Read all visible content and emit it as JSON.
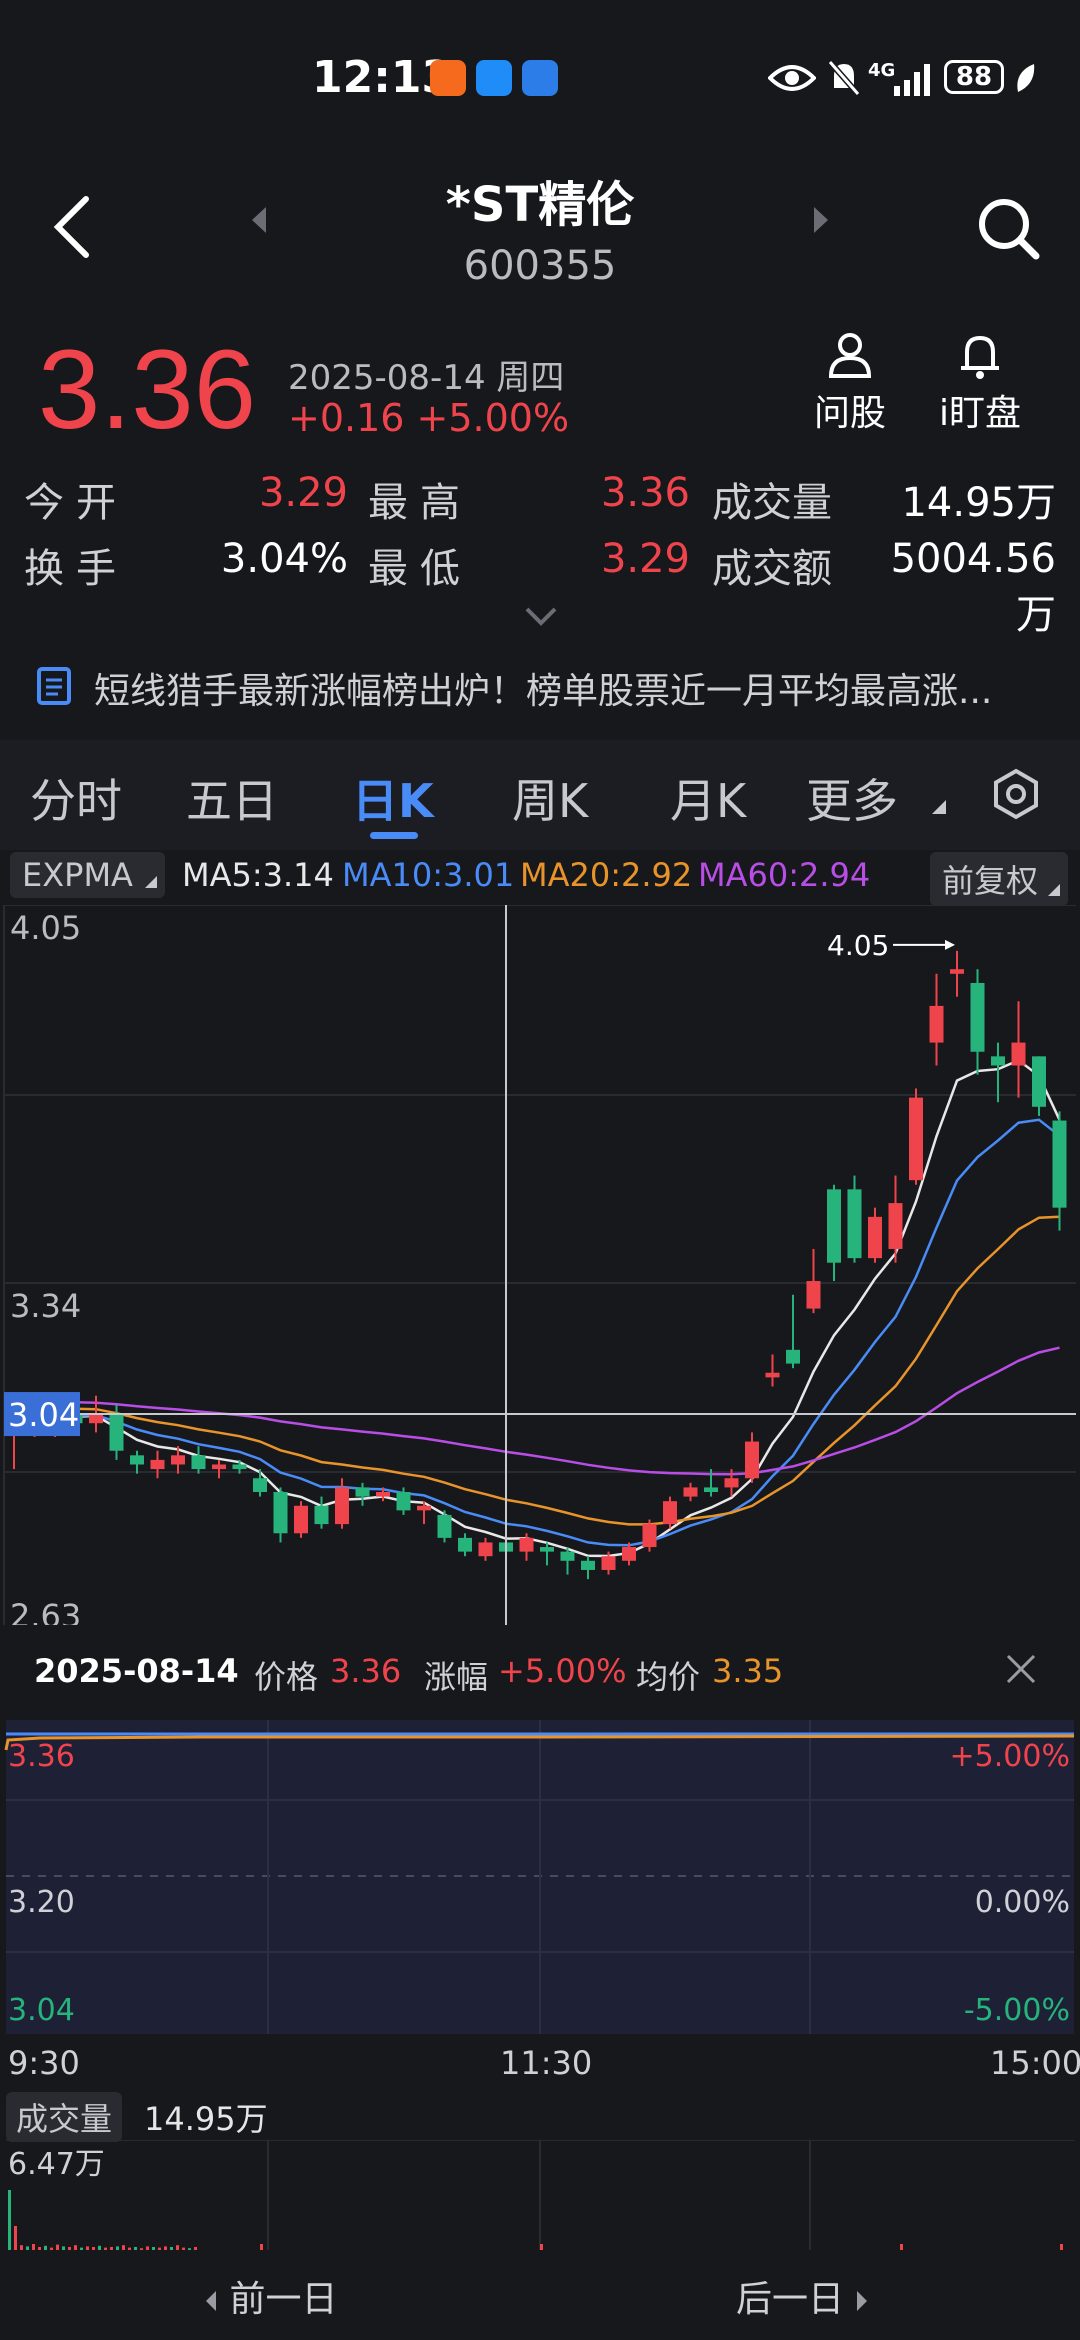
{
  "status_bar": {
    "time": "12:13",
    "network": "4G",
    "battery": "88"
  },
  "header": {
    "title": "*ST精伦",
    "code": "600355"
  },
  "quote": {
    "price": "3.36",
    "date": "2025-08-14 周四",
    "change": "+0.16 +5.00%",
    "actions": [
      {
        "label": "问股",
        "icon": "person-icon"
      },
      {
        "label": "i盯盘",
        "icon": "bell-icon"
      }
    ]
  },
  "stats": {
    "open_label": "今开",
    "open_value": "3.29",
    "high_label": "最高",
    "high_value": "3.36",
    "volume_label": "成交量",
    "volume_value": "14.95万",
    "turnover_label": "换手",
    "turnover_value": "3.04%",
    "low_label": "最低",
    "low_value": "3.29",
    "amount_label": "成交额",
    "amount_value": "5004.56万"
  },
  "news": {
    "text": "短线猎手最新涨幅榜出炉！榜单股票近一月平均最高涨..."
  },
  "tabs": [
    "分时",
    "五日",
    "日K",
    "周K",
    "月K",
    "更多"
  ],
  "active_tab": "日K",
  "indicators": {
    "type": "EXPMA",
    "ma5": "MA5:3.14",
    "ma10": "MA10:3.01",
    "ma20": "MA20:2.92",
    "ma60": "MA60:2.94",
    "adjust": "前复权",
    "colors": {
      "ma5": "#e8e8e8",
      "ma10": "#4a8cf7",
      "ma20": "#e8942a",
      "ma60": "#b84ee6"
    }
  },
  "chart_data": {
    "type": "candlestick",
    "y_ticks": [
      "4.05",
      "3.34",
      "2.63"
    ],
    "ylim": [
      2.58,
      4.15
    ],
    "crosshair_price": "3.04",
    "max_label": "4.05",
    "up_color": "#f0444c",
    "down_color": "#26b37c",
    "candles": [
      [
        3.0,
        3.04,
        2.92,
        3.06
      ],
      [
        3.01,
        3.03,
        2.99,
        3.05
      ],
      [
        3.02,
        3.05,
        2.99,
        3.07
      ],
      [
        3.04,
        3.02,
        3.0,
        3.06
      ],
      [
        3.02,
        3.04,
        3.0,
        3.08
      ],
      [
        3.04,
        2.96,
        2.94,
        3.06
      ],
      [
        2.95,
        2.93,
        2.91,
        2.96
      ],
      [
        2.92,
        2.94,
        2.9,
        2.96
      ],
      [
        2.93,
        2.95,
        2.91,
        2.97
      ],
      [
        2.95,
        2.92,
        2.91,
        2.97
      ],
      [
        2.92,
        2.93,
        2.9,
        2.94
      ],
      [
        2.93,
        2.92,
        2.91,
        2.94
      ],
      [
        2.9,
        2.87,
        2.86,
        2.92
      ],
      [
        2.87,
        2.78,
        2.76,
        2.88
      ],
      [
        2.78,
        2.84,
        2.77,
        2.85
      ],
      [
        2.84,
        2.8,
        2.79,
        2.86
      ],
      [
        2.8,
        2.88,
        2.79,
        2.9
      ],
      [
        2.88,
        2.86,
        2.84,
        2.89
      ],
      [
        2.86,
        2.87,
        2.85,
        2.88
      ],
      [
        2.87,
        2.83,
        2.82,
        2.88
      ],
      [
        2.83,
        2.84,
        2.8,
        2.85
      ],
      [
        2.82,
        2.77,
        2.76,
        2.83
      ],
      [
        2.77,
        2.74,
        2.73,
        2.78
      ],
      [
        2.73,
        2.76,
        2.72,
        2.77
      ],
      [
        2.76,
        2.74,
        2.72,
        2.77
      ],
      [
        2.74,
        2.77,
        2.72,
        2.78
      ],
      [
        2.75,
        2.74,
        2.71,
        2.76
      ],
      [
        2.74,
        2.72,
        2.69,
        2.75
      ],
      [
        2.72,
        2.7,
        2.68,
        2.73
      ],
      [
        2.7,
        2.73,
        2.69,
        2.74
      ],
      [
        2.72,
        2.75,
        2.71,
        2.76
      ],
      [
        2.75,
        2.8,
        2.74,
        2.81
      ],
      [
        2.8,
        2.85,
        2.79,
        2.86
      ],
      [
        2.86,
        2.88,
        2.85,
        2.89
      ],
      [
        2.88,
        2.87,
        2.86,
        2.92
      ],
      [
        2.88,
        2.9,
        2.86,
        2.92
      ],
      [
        2.9,
        2.98,
        2.89,
        3.0
      ],
      [
        3.12,
        3.13,
        3.1,
        3.17
      ],
      [
        3.18,
        3.15,
        3.14,
        3.3
      ],
      [
        3.27,
        3.33,
        3.26,
        3.4
      ],
      [
        3.53,
        3.37,
        3.33,
        3.54
      ],
      [
        3.53,
        3.38,
        3.37,
        3.56
      ],
      [
        3.38,
        3.47,
        3.37,
        3.49
      ],
      [
        3.4,
        3.5,
        3.37,
        3.56
      ],
      [
        3.55,
        3.73,
        3.54,
        3.75
      ],
      [
        3.85,
        3.93,
        3.8,
        4.0
      ],
      [
        4.0,
        4.01,
        3.95,
        4.05
      ],
      [
        3.98,
        3.83,
        3.78,
        4.01
      ],
      [
        3.82,
        3.8,
        3.72,
        3.85
      ],
      [
        3.8,
        3.85,
        3.73,
        3.94
      ],
      [
        3.82,
        3.71,
        3.69,
        3.82
      ],
      [
        3.68,
        3.49,
        3.44,
        3.7
      ]
    ]
  },
  "info_bar": {
    "date": "2025-08-14",
    "price_label": "价格",
    "price_value": "3.36",
    "change_label": "涨幅",
    "change_value": "+5.00%",
    "avg_label": "均价",
    "avg_value": "3.35"
  },
  "intraday": {
    "y_left": [
      "3.36",
      "3.20",
      "3.04"
    ],
    "y_right": [
      "+5.00%",
      "0.00%",
      "-5.00%"
    ],
    "x_labels": [
      "9:30",
      "11:30",
      "15:00"
    ],
    "price_line_color": "#4a8cf7",
    "avg_line_color": "#e8942a",
    "volume_label": "成交量",
    "volume_value": "14.95万",
    "volume_max": "6.47万"
  },
  "bottom_nav": {
    "prev": "前一日",
    "next": "后一日"
  }
}
